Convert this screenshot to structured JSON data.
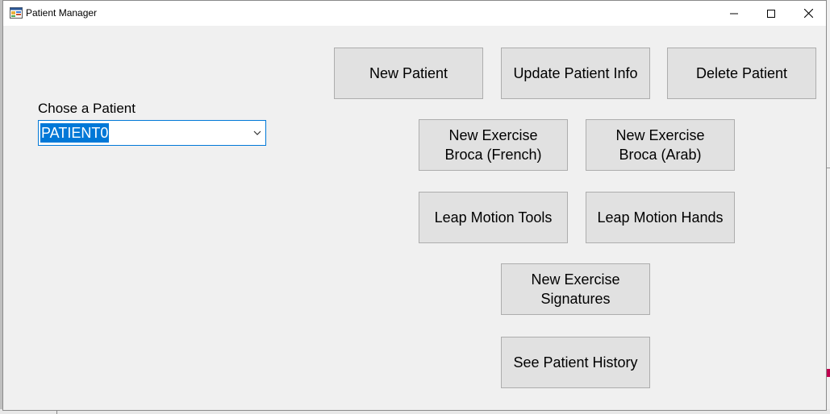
{
  "window": {
    "title": "Patient Manager"
  },
  "patient_selector": {
    "label": "Chose a Patient",
    "selected_value": "PATIENT0"
  },
  "buttons": {
    "new_patient": "New Patient",
    "update_patient_info": "Update Patient Info",
    "delete_patient": "Delete Patient",
    "new_exercise_broca_french": "New Exercise\nBroca (French)",
    "new_exercise_broca_arab": "New Exercise\nBroca (Arab)",
    "leap_motion_tools": "Leap Motion Tools",
    "leap_motion_hands": "Leap Motion Hands",
    "new_exercise_signatures": "New Exercise\nSignatures",
    "see_patient_history": "See Patient History"
  },
  "colors": {
    "accent": "#0078d7",
    "button_bg": "#e1e1e1",
    "window_bg": "#f0f0f0"
  }
}
